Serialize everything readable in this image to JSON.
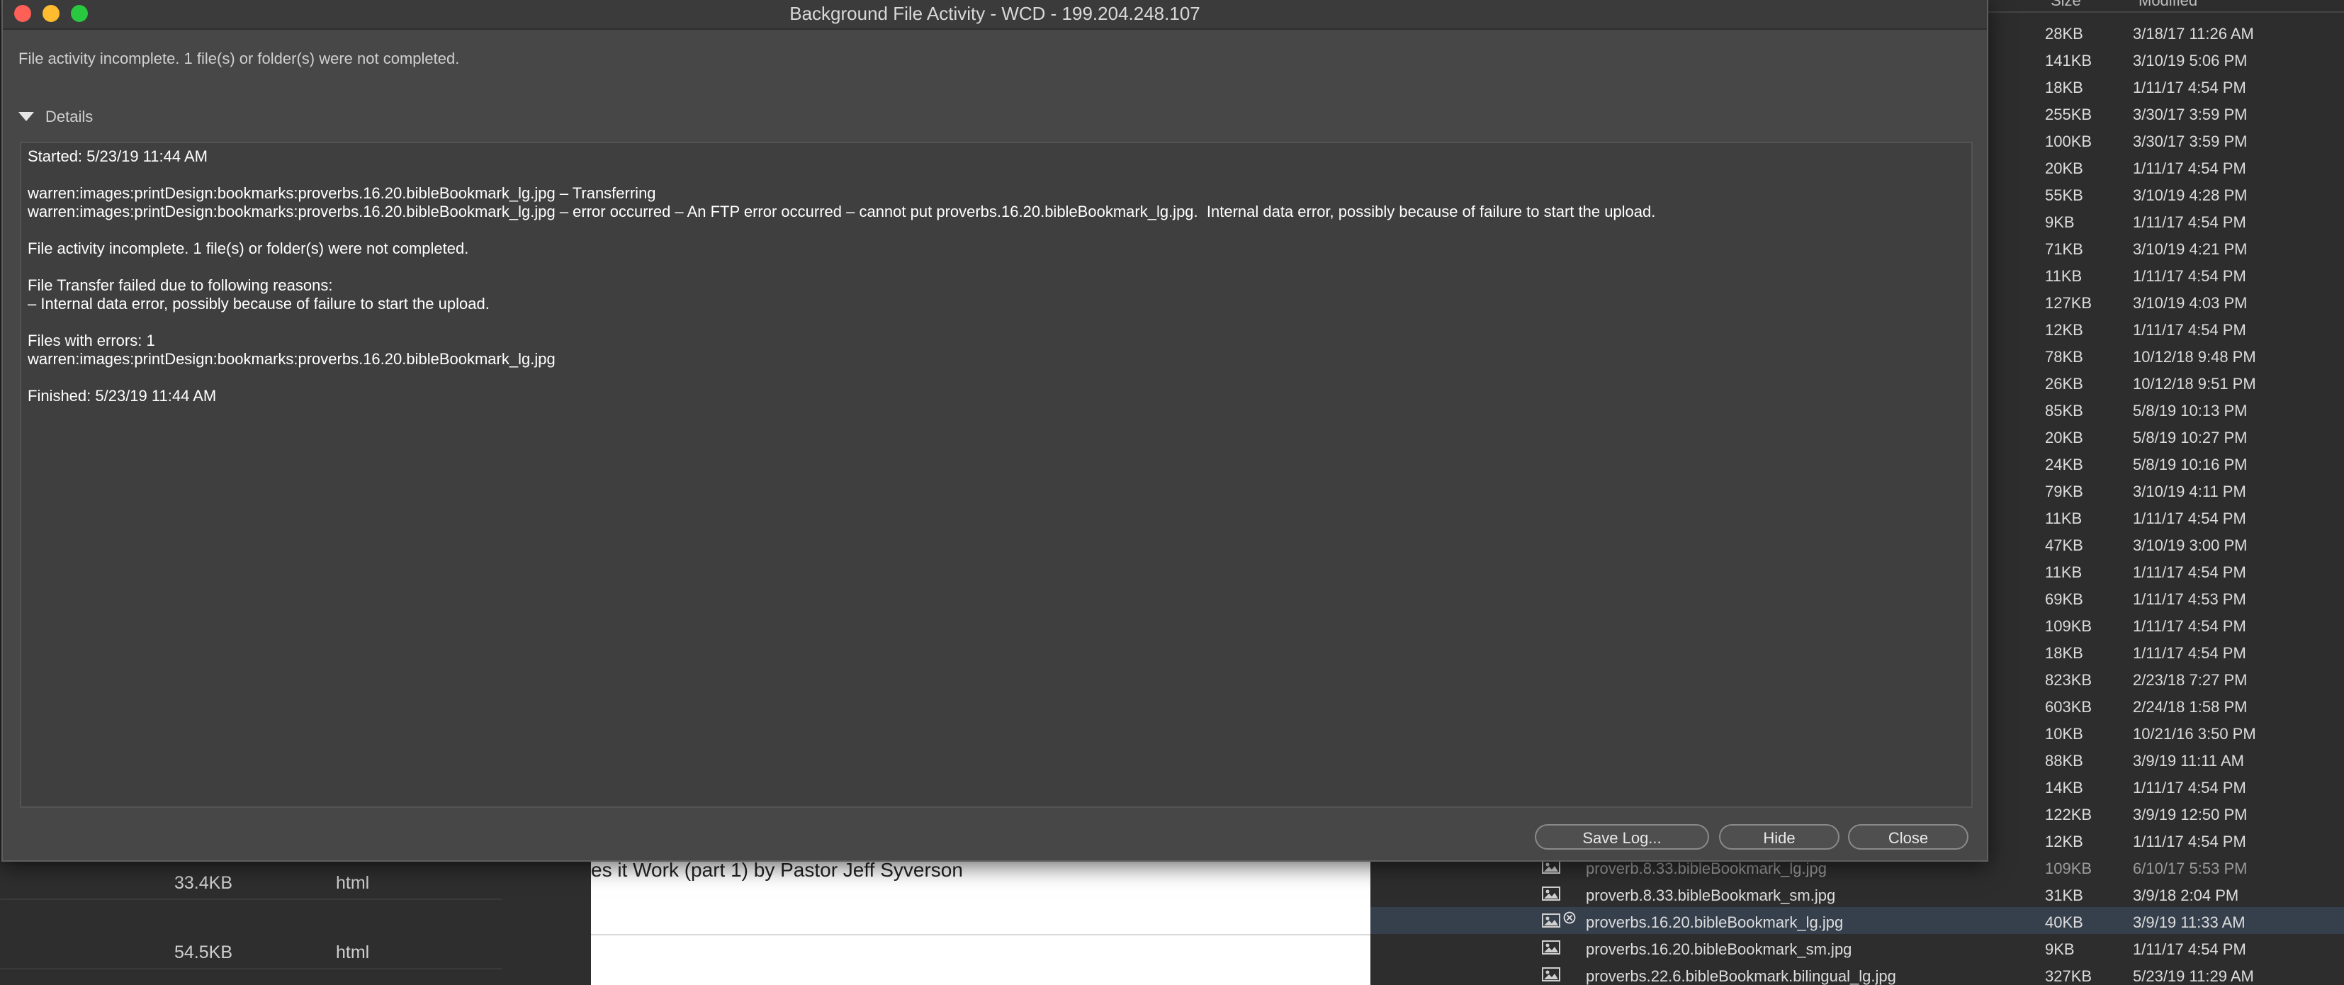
{
  "dialog": {
    "title": "Background File Activity - WCD - 199.204.248.107",
    "summary": "File activity incomplete. 1 file(s) or folder(s) were not completed.",
    "details_label": "Details",
    "log": [
      "Started: 5/23/19 11:44 AM",
      "",
      "warren:images:printDesign:bookmarks:proverbs.16.20.bibleBookmark_lg.jpg – Transferring",
      "warren:images:printDesign:bookmarks:proverbs.16.20.bibleBookmark_lg.jpg – error occurred – An FTP error occurred – cannot put proverbs.16.20.bibleBookmark_lg.jpg.  Internal data error, possibly because of failure to start the upload.",
      "",
      "File activity incomplete. 1 file(s) or folder(s) were not completed.",
      "",
      "File Transfer failed due to following reasons:",
      "– Internal data error, possibly because of failure to start the upload.",
      "",
      "Files with errors: 1",
      "warren:images:printDesign:bookmarks:proverbs.16.20.bibleBookmark_lg.jpg",
      "",
      "Finished: 5/23/19 11:44 AM"
    ],
    "buttons": {
      "save_log": "Save Log...",
      "hide": "Hide",
      "close": "Close"
    },
    "colors": {
      "close": "#fe5f57",
      "minimize": "#febc2e",
      "zoom": "#28c840"
    }
  },
  "left_panel": {
    "rows": [
      {
        "size": "33.4KB",
        "type": "html"
      },
      {
        "size": "54.5KB",
        "type": "html"
      }
    ]
  },
  "preview": {
    "title": "es it Work (part 1) by Pastor Jeff Syverson"
  },
  "file_list": {
    "headers": {
      "size": "Size",
      "modified": "Modified"
    },
    "rows": [
      {
        "size": "28KB",
        "modified": "3/18/17 11:26 AM"
      },
      {
        "size": "141KB",
        "modified": "3/10/19 5:06 PM"
      },
      {
        "size": "18KB",
        "modified": "1/11/17 4:54 PM"
      },
      {
        "size": "255KB",
        "modified": "3/30/17 3:59 PM"
      },
      {
        "size": "100KB",
        "modified": "3/30/17 3:59 PM"
      },
      {
        "size": "20KB",
        "modified": "1/11/17 4:54 PM"
      },
      {
        "size": "55KB",
        "modified": "3/10/19 4:28 PM"
      },
      {
        "size": "9KB",
        "modified": "1/11/17 4:54 PM"
      },
      {
        "size": "71KB",
        "modified": "3/10/19 4:21 PM"
      },
      {
        "size": "11KB",
        "modified": "1/11/17 4:54 PM"
      },
      {
        "size": "127KB",
        "modified": "3/10/19 4:03 PM"
      },
      {
        "size": "12KB",
        "modified": "1/11/17 4:54 PM"
      },
      {
        "size": "78KB",
        "modified": "10/12/18 9:48 PM"
      },
      {
        "size": "26KB",
        "modified": "10/12/18 9:51 PM"
      },
      {
        "size": "85KB",
        "modified": "5/8/19 10:13 PM"
      },
      {
        "size": "20KB",
        "modified": "5/8/19 10:27 PM"
      },
      {
        "size": "24KB",
        "modified": "5/8/19 10:16 PM"
      },
      {
        "size": "79KB",
        "modified": "3/10/19 4:11 PM"
      },
      {
        "size": "11KB",
        "modified": "1/11/17 4:54 PM"
      },
      {
        "size": "47KB",
        "modified": "3/10/19 3:00 PM"
      },
      {
        "size": "11KB",
        "modified": "1/11/17 4:54 PM"
      },
      {
        "size": "69KB",
        "modified": "1/11/17 4:53 PM"
      },
      {
        "size": "109KB",
        "modified": "1/11/17 4:54 PM"
      },
      {
        "size": "18KB",
        "modified": "1/11/17 4:54 PM"
      },
      {
        "size": "823KB",
        "modified": "2/23/18 7:27 PM"
      },
      {
        "size": "603KB",
        "modified": "2/24/18 1:58 PM"
      },
      {
        "size": "10KB",
        "modified": "10/21/16 3:50 PM"
      },
      {
        "size": "88KB",
        "modified": "3/9/19 11:11 AM"
      },
      {
        "size": "14KB",
        "modified": "1/11/17 4:54 PM"
      },
      {
        "size": "122KB",
        "modified": "3/9/19 12:50 PM"
      },
      {
        "size": "12KB",
        "modified": "1/11/17 4:54 PM"
      },
      {
        "name": "proverb.8.33.bibleBookmark_lg.jpg",
        "size": "109KB",
        "modified": "6/10/17 5:53 PM",
        "faded": true
      },
      {
        "name": "proverb.8.33.bibleBookmark_sm.jpg",
        "size": "31KB",
        "modified": "3/9/18 2:04 PM"
      },
      {
        "name": "proverbs.16.20.bibleBookmark_lg.jpg",
        "size": "40KB",
        "modified": "3/9/19 11:33 AM",
        "selected": true,
        "error": true
      },
      {
        "name": "proverbs.16.20.bibleBookmark_sm.jpg",
        "size": "9KB",
        "modified": "1/11/17 4:54 PM"
      },
      {
        "name": "proverbs.22.6.bibleBookmark.bilingual_lg.jpg",
        "size": "327KB",
        "modified": "5/23/19 11:29 AM"
      }
    ]
  }
}
